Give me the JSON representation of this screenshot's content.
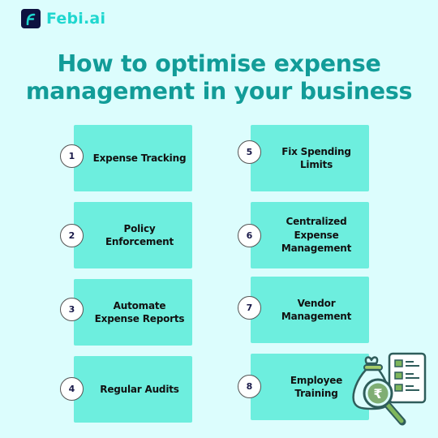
{
  "brand": {
    "name": "Febi.ai",
    "logo_icon": "febi-f-logo-icon",
    "color": "#1fd7cf"
  },
  "title": {
    "line1": "How to optimise expense",
    "line2": "management in your business",
    "color": "#129c98"
  },
  "colors": {
    "background": "#dcfdfd",
    "card": "#6deede",
    "number_text": "#1a1a4a"
  },
  "steps": [
    {
      "number": "1",
      "label": "Expense Tracking"
    },
    {
      "number": "2",
      "label": "Policy Enforcement"
    },
    {
      "number": "3",
      "label": "Automate Expense Reports"
    },
    {
      "number": "4",
      "label": "Regular Audits"
    },
    {
      "number": "5",
      "label": "Fix Spending Limits"
    },
    {
      "number": "6",
      "label": "Centralized Expense Management"
    },
    {
      "number": "7",
      "label": "Vendor Management"
    },
    {
      "number": "8",
      "label": "Employee Training"
    }
  ],
  "illustration": {
    "icon": "money-bag-rupee-magnifier-checklist-icon",
    "currency_symbol": "₹"
  }
}
